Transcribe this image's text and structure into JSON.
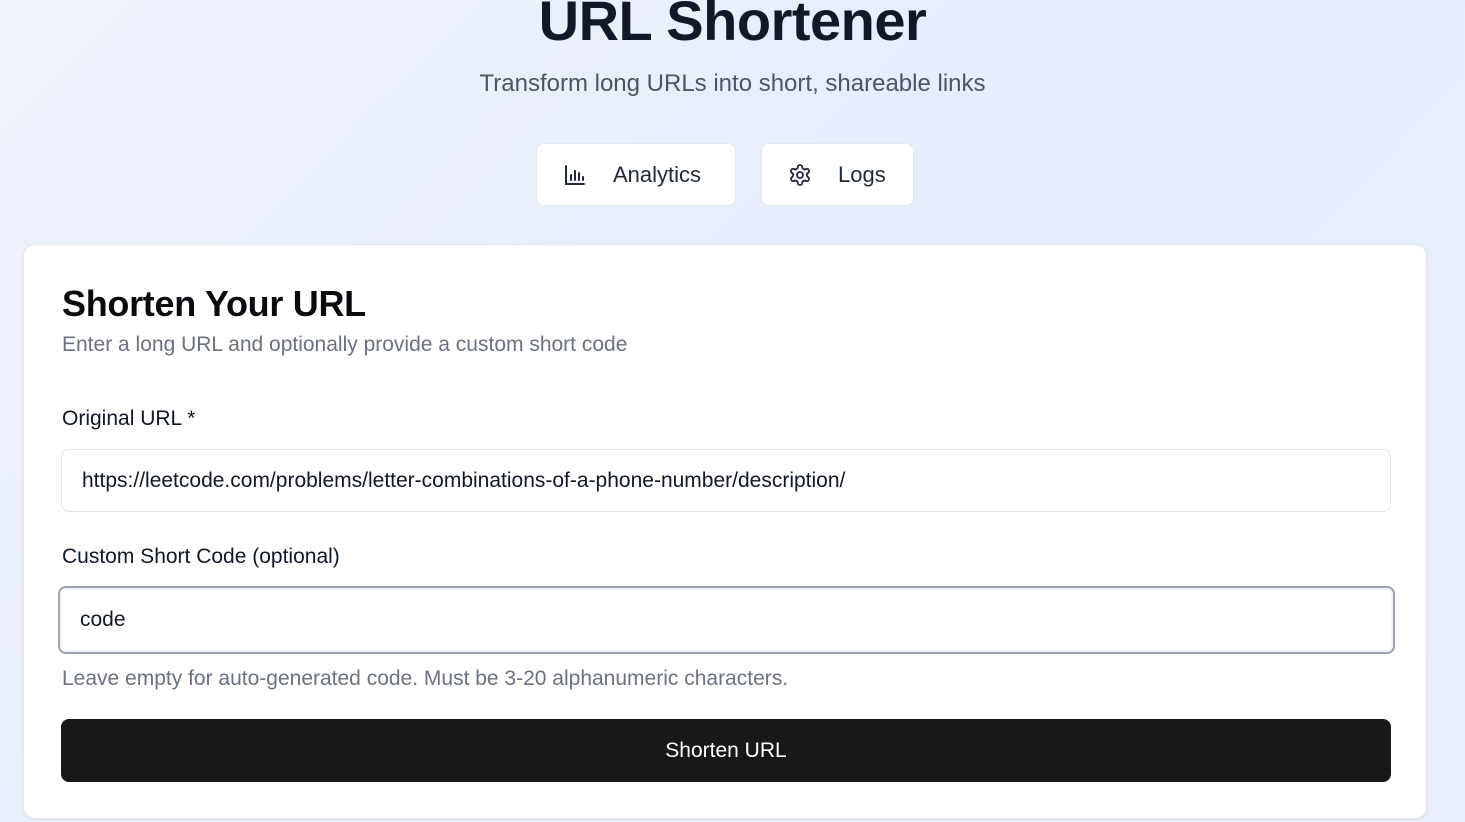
{
  "header": {
    "title": "URL Shortener",
    "subtitle": "Transform long URLs into short, shareable links"
  },
  "nav": {
    "analytics_label": "Analytics",
    "analytics_icon": "bar-chart-icon",
    "logs_label": "Logs",
    "logs_icon": "gear-icon"
  },
  "card": {
    "title": "Shorten Your URL",
    "description": "Enter a long URL and optionally provide a custom short code",
    "url_label": "Original URL *",
    "url_value": "https://leetcode.com/problems/letter-combinations-of-a-phone-number/description/",
    "code_label": "Custom Short Code (optional)",
    "code_value": "code",
    "hint": "Leave empty for auto-generated code. Must be 3-20 alphanumeric characters.",
    "submit_label": "Shorten URL"
  },
  "colors": {
    "primary_button": "#18181b",
    "background": "#e8eefc"
  }
}
